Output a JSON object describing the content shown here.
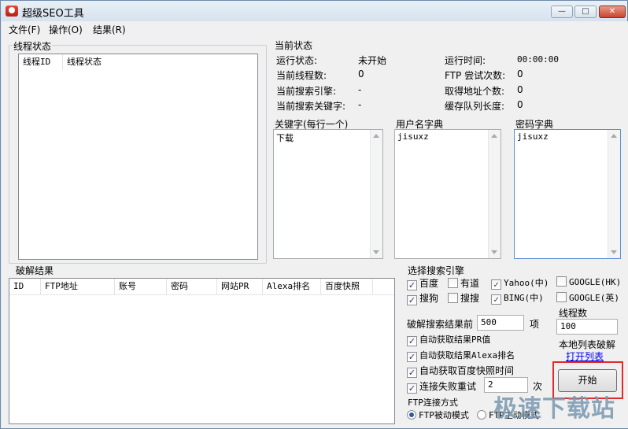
{
  "window": {
    "title": "超级SEO工具",
    "min": "—",
    "max": "□",
    "close": "✕"
  },
  "menubar": [
    "文件(F)",
    "操作(O)",
    "结果(R)"
  ],
  "thread_status": {
    "label": "线程状态",
    "columns": [
      "线程ID",
      "线程状态"
    ]
  },
  "current_status": {
    "label": "当前状态",
    "rows": [
      {
        "k": "运行状态:",
        "v": "未开始"
      },
      {
        "k": "当前线程数:",
        "v": "0"
      },
      {
        "k": "当前搜索引擎:",
        "v": "-"
      },
      {
        "k": "当前搜索关键字:",
        "v": "-"
      }
    ],
    "rows_right": [
      {
        "k": "运行时间:",
        "v": "00:00:00"
      },
      {
        "k": "FTP 尝试次数:",
        "v": "0"
      },
      {
        "k": "取得地址个数:",
        "v": "0"
      },
      {
        "k": "缓存队列长度:",
        "v": "0"
      }
    ]
  },
  "keywords": {
    "label": "关键字(每行一个)",
    "value": "下载"
  },
  "user_dict": {
    "label": "用户名字典",
    "value": "jisuxz"
  },
  "pass_dict": {
    "label": "密码字典",
    "value": "jisuxz"
  },
  "results": {
    "label": "破解结果",
    "columns": [
      "ID",
      "FTP地址",
      "账号",
      "密码",
      "网站PR",
      "Alexa排名",
      "百度快照"
    ]
  },
  "engines": {
    "label": "选择搜索引擎",
    "items": [
      {
        "label": "百度",
        "checked": true
      },
      {
        "label": "有道",
        "checked": false
      },
      {
        "label": "Yahoo(中)",
        "checked": true
      },
      {
        "label": "GOOGLE(HK)",
        "checked": false
      },
      {
        "label": "搜狗",
        "checked": true
      },
      {
        "label": "搜搜",
        "checked": false
      },
      {
        "label": "BING(中)",
        "checked": true
      },
      {
        "label": "GOOGLE(英)",
        "checked": false
      }
    ]
  },
  "options": {
    "crack_prefix": "破解搜索结果前",
    "crack_count": "500",
    "crack_unit": "项",
    "auto_pr": "自动获取结果PR值",
    "auto_alexa": "自动获取结果Alexa排名",
    "auto_baidu": "自动获取百度快照时间",
    "retry_label": "连接失败重试",
    "retry_count": "2",
    "retry_unit": "次"
  },
  "ftp_mode": {
    "label": "FTP连接方式",
    "passive": "FTP被动模式",
    "active": "FTP主动模式"
  },
  "threads": {
    "label": "线程数",
    "value": "100"
  },
  "local": {
    "label": "本地列表破解",
    "open_link": "打开列表"
  },
  "start_button": "开始",
  "watermark": "极速下载站",
  "check_mark": "✓",
  "colors": {
    "highlight": "#e12a2a",
    "link": "#0000ee"
  }
}
